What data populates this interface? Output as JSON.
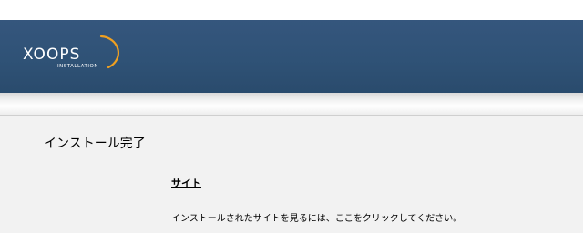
{
  "header": {
    "logo_text": "XOOPS",
    "logo_subtext": "INSTALLATION",
    "colors": {
      "background": "#2f5276",
      "logo_accent": "#f0a020"
    }
  },
  "main": {
    "page_title": "インストール完了",
    "site_section": {
      "heading": "サイト",
      "text_before": "インストールされたサイトを見るには、",
      "link_text": "ここ",
      "text_after": "をクリックしてください。"
    }
  }
}
